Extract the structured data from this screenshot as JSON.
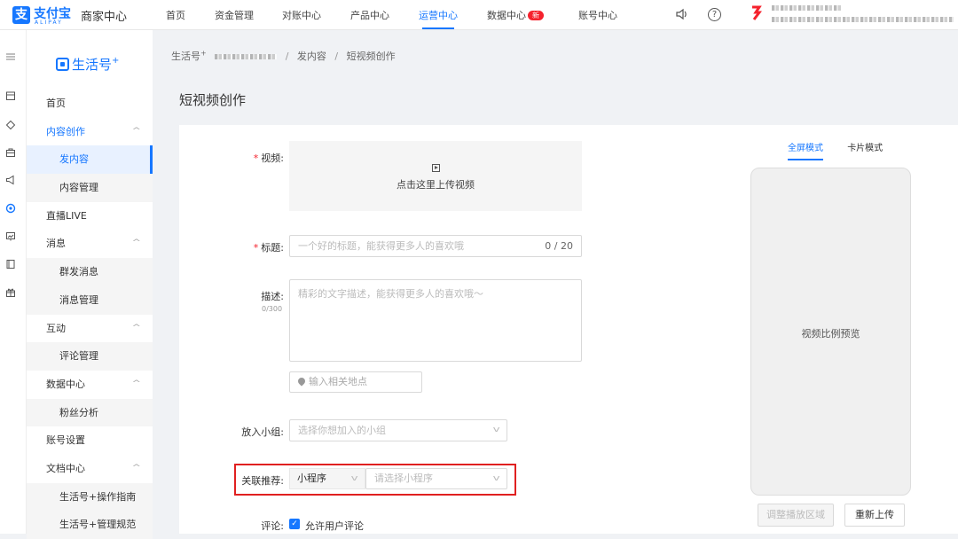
{
  "topbar": {
    "logo_mark": "支",
    "logo_cn": "支付宝",
    "logo_en": "ALIPAY",
    "merchant": "商家中心",
    "nav": [
      "首页",
      "资金管理",
      "对账中心",
      "产品中心",
      "运营中心",
      "数据中心",
      "账号中心"
    ],
    "active_nav": "运营中心",
    "new_badge": "新",
    "help_symbol": "?",
    "accent_color": "#1677ff"
  },
  "rail": {
    "icons": [
      "menu-icon",
      "store-icon",
      "tag-icon",
      "briefcase-icon",
      "megaphone-icon",
      "settings-circle-icon",
      "chart-screen-icon",
      "book-icon",
      "gift-icon"
    ]
  },
  "sidebar": {
    "brand": "生活号",
    "brand_sup": "+",
    "items": [
      {
        "label": "首页",
        "level": 1
      },
      {
        "label": "内容创作",
        "level": 1,
        "expanded": true
      },
      {
        "label": "发内容",
        "level": 2,
        "selected": true
      },
      {
        "label": "内容管理",
        "level": 2
      },
      {
        "label": "直播LIVE",
        "level": 1
      },
      {
        "label": "消息",
        "level": 1,
        "expanded": true
      },
      {
        "label": "群发消息",
        "level": 2
      },
      {
        "label": "消息管理",
        "level": 2
      },
      {
        "label": "互动",
        "level": 1,
        "expanded": true
      },
      {
        "label": "评论管理",
        "level": 2
      },
      {
        "label": "数据中心",
        "level": 1,
        "expanded": true
      },
      {
        "label": "粉丝分析",
        "level": 2
      },
      {
        "label": "账号设置",
        "level": 1
      },
      {
        "label": "文档中心",
        "level": 1,
        "expanded": true
      },
      {
        "label": "生活号+操作指南",
        "level": 2
      },
      {
        "label": "生活号+管理规范",
        "level": 2
      }
    ]
  },
  "breadcrumb": {
    "root": "生活号",
    "root_sup": "+",
    "sep": "/",
    "level2": "发内容",
    "level3": "短视频创作"
  },
  "page_title": "短视频创作",
  "form": {
    "video_label": "视频:",
    "upload_text": "点击这里上传视频",
    "title_label": "标题:",
    "title_placeholder": "一个好的标题，能获得更多人的喜欢哦",
    "title_counter": "0 / 20",
    "desc_label": "描述:",
    "desc_counter": "0/300",
    "desc_placeholder": "精彩的文字描述，能获得更多人的喜欢哦～",
    "location_placeholder": "输入相关地点",
    "group_label": "放入小组:",
    "group_placeholder": "选择你想加入的小组",
    "related_label": "关联推荐:",
    "related_type": "小程序",
    "related_placeholder": "请选择小程序",
    "comment_label": "评论:",
    "comment_option": "允许用户评论",
    "required_mark": "*",
    "check_mark": "✓",
    "chevron": "v"
  },
  "preview": {
    "tab_full": "全屏模式",
    "tab_card": "卡片模式",
    "active_tab": "全屏模式",
    "placeholder": "视频比例预览",
    "btn_adjust": "调整播放区域",
    "btn_reupload": "重新上传"
  }
}
